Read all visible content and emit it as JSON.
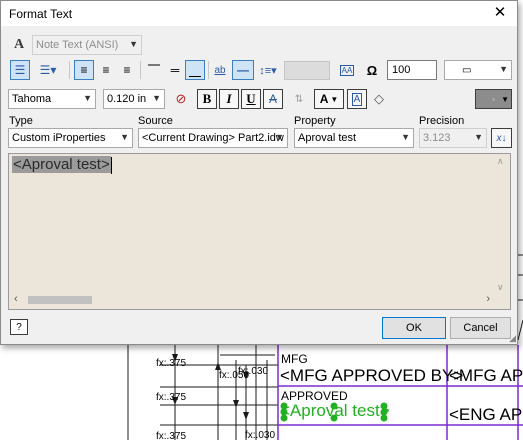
{
  "dialog": {
    "title": "Format Text",
    "style": "Note Text (ANSI)",
    "width_scale": "100",
    "font": "Tahoma",
    "font_size": "0.120 in",
    "type_label": "Type",
    "type_value": "Custom iProperties",
    "source_label": "Source",
    "source_value": "<Current Drawing> Part2.idw",
    "property_label": "Property",
    "property_value": "Aproval test",
    "precision_label": "Precision",
    "precision_value": "3.123",
    "editor_text": "<Aproval test>",
    "ok": "OK",
    "cancel": "Cancel",
    "bold_glyph": "B",
    "italic_glyph": "I",
    "underline_glyph": "U",
    "strike_glyph": "A",
    "style_letter": "A",
    "insert_symbol_glyph": "A"
  },
  "drawing": {
    "dims": [
      "fx:.375",
      "fx:.375",
      "fx:.375",
      "fx:.050",
      "fx:.030",
      "fx:.030"
    ],
    "mfg": "MFG",
    "mfg_approved_by": "<MFG APPROVED BY>",
    "mfg_app": "<MFG APP",
    "approved": "APPROVED",
    "aproval_test": "<Aproval test>",
    "eng_app": "<ENG APP",
    "colors": {
      "line": "#1a1a1a",
      "purple": "#7b2bd0",
      "green": "#22b022"
    }
  }
}
